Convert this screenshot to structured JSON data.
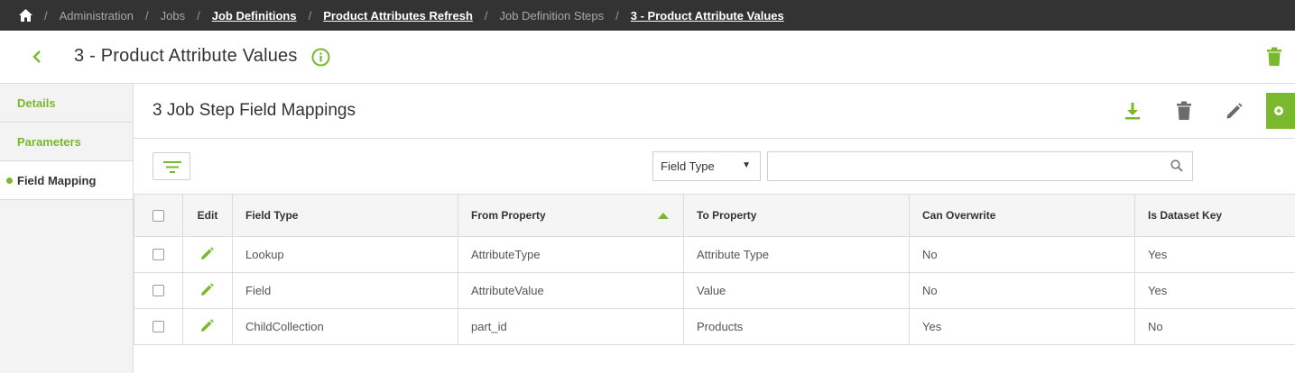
{
  "breadcrumb": {
    "items": [
      {
        "label": "Administration"
      },
      {
        "label": "Jobs"
      },
      {
        "label": "Job Definitions"
      },
      {
        "label": "Product Attributes Refresh"
      },
      {
        "label": "Job Definition Steps"
      },
      {
        "label": "3 - Product Attribute Values"
      }
    ]
  },
  "header": {
    "title": "3 - Product Attribute Values"
  },
  "sidebar": {
    "items": [
      {
        "label": "Details"
      },
      {
        "label": "Parameters"
      },
      {
        "label": "Field Mapping"
      }
    ]
  },
  "panel": {
    "title": "3 Job Step Field Mappings"
  },
  "filter": {
    "select_value": "Field Type",
    "search_value": ""
  },
  "table": {
    "columns": [
      "Edit",
      "Field Type",
      "From Property",
      "To Property",
      "Can Overwrite",
      "Is Dataset Key"
    ],
    "sorted_column": "From Property",
    "sort_direction": "ascending",
    "rows": [
      {
        "field_type": "Lookup",
        "from": "AttributeType",
        "to": "Attribute Type",
        "overwrite": "No",
        "key": "Yes"
      },
      {
        "field_type": "Field",
        "from": "AttributeValue",
        "to": "Value",
        "overwrite": "No",
        "key": "Yes"
      },
      {
        "field_type": "ChildCollection",
        "from": "part_id",
        "to": "Products",
        "overwrite": "Yes",
        "key": "No"
      }
    ]
  },
  "colors": {
    "accent": "#7ab82e",
    "topbar": "#333333",
    "icon_gray": "#6b6b6b"
  },
  "icons": [
    "home-icon",
    "back-icon",
    "info-icon",
    "trash-icon",
    "download-icon",
    "pencil-icon",
    "add-icon",
    "filter-icon",
    "search-icon",
    "sort-asc-icon"
  ]
}
